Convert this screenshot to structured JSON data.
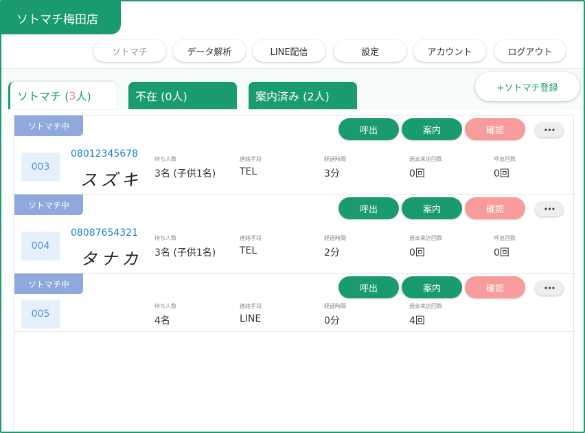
{
  "store": {
    "name": "ソトマチ梅田店"
  },
  "nav": [
    {
      "label": "ソトマチ",
      "active": true
    },
    {
      "label": "データ解析"
    },
    {
      "label": "LINE配信"
    },
    {
      "label": "設定"
    },
    {
      "label": "アカウント"
    },
    {
      "label": "ログアウト"
    }
  ],
  "tabs": [
    {
      "label_prefix": "ソトマチ (",
      "count": "3",
      "label_suffix": "人)"
    },
    {
      "label": "不在 (0人)"
    },
    {
      "label": "案内済み (2人)"
    }
  ],
  "register_button": "+ソトマチ登録",
  "labels": {
    "status": "ソトマチ中",
    "call": "呼出",
    "guide": "案内",
    "confirm": "確認",
    "more": "•••",
    "party": "待ち人数",
    "contact": "連絡手段",
    "elapsed": "経過時間",
    "visits": "過去来店回数",
    "calls": "呼出回数"
  },
  "entries": [
    {
      "number": "003",
      "phone": "08012345678",
      "name": "スズキ",
      "party": "3名 (子供1名)",
      "contact": "TEL",
      "elapsed": "3分",
      "visits": "0回",
      "calls": "0回"
    },
    {
      "number": "004",
      "phone": "08087654321",
      "name": "タナカ",
      "party": "3名 (子供1名)",
      "contact": "TEL",
      "elapsed": "2分",
      "visits": "0回",
      "calls": "0回"
    },
    {
      "number": "005",
      "phone": "",
      "name": "",
      "party": "4名",
      "contact": "LINE",
      "elapsed": "0分",
      "visits": "4回",
      "calls": ""
    }
  ],
  "colors": {
    "brand": "#1a9b6f",
    "status_chip": "#8fa9dc",
    "confirm": "#f79b9b",
    "phone": "#1a7fd6"
  }
}
